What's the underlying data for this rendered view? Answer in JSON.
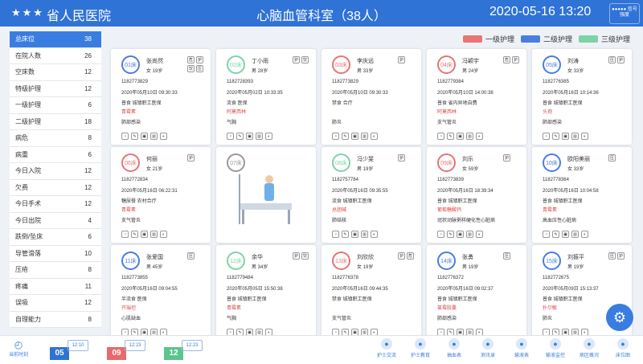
{
  "header": {
    "stars": "★★★",
    "hospital": "省人民医院",
    "department": "心脑血管科室（38人）",
    "datetime": "2020-05-16  13:20",
    "signal": "●●●●● 信号强度"
  },
  "sidebar": [
    {
      "label": "总床位",
      "count": "38",
      "active": true
    },
    {
      "label": "在院人数",
      "count": "26"
    },
    {
      "label": "空床数",
      "count": "12"
    },
    {
      "label": "特级护理",
      "count": "12"
    },
    {
      "label": "一级护理",
      "count": "6"
    },
    {
      "label": "二级护理",
      "count": "18"
    },
    {
      "label": "病危",
      "count": "8"
    },
    {
      "label": "病重",
      "count": "6"
    },
    {
      "label": "今日入院",
      "count": "12"
    },
    {
      "label": "欠费",
      "count": "12"
    },
    {
      "label": "今日手术",
      "count": "12"
    },
    {
      "label": "今日出院",
      "count": "4"
    },
    {
      "label": "跌倒/坠床",
      "count": "6"
    },
    {
      "label": "导管滑落",
      "count": "10"
    },
    {
      "label": "压疮",
      "count": "8"
    },
    {
      "label": "疼痛",
      "count": "11"
    },
    {
      "label": "误吸",
      "count": "12"
    },
    {
      "label": "自理能力",
      "count": "8"
    }
  ],
  "legend": [
    {
      "label": "一级护理",
      "color": "#e87474"
    },
    {
      "label": "二级护理",
      "color": "#4a7de0"
    },
    {
      "label": "三级护理",
      "color": "#7dd3a8"
    }
  ],
  "patients": [
    {
      "bed": "01床",
      "name": "张尚然",
      "sex": "女",
      "age": "19岁",
      "id": "1182773829",
      "date": "2020年05月10日",
      "time": "09:30:33",
      "diet": "普食",
      "ins": "城镇职工医保",
      "alert": "青霉素",
      "diag": "肺部感染",
      "color": "#4a7de0",
      "tags": [
        "危",
        "护",
        "饮",
        "压"
      ]
    },
    {
      "bed": "02床",
      "name": "丁小雨",
      "sex": "男",
      "age": "28岁",
      "id": "1182728393",
      "date": "2020年05月02日",
      "time": "10:33:35",
      "diet": "流食",
      "ins": "医保",
      "alert": "阿莫西林",
      "diag": "气胸",
      "color": "#7dd3a8",
      "tags": [
        "护",
        "饮"
      ]
    },
    {
      "bed": "03床",
      "name": "李庆远",
      "sex": "男",
      "age": "33岁",
      "id": "1182773829",
      "date": "2020年05月10日",
      "time": "09:30:33",
      "diet": "禁食",
      "ins": "合疗",
      "alert": "",
      "diag": "肺炎",
      "color": "#e87474",
      "tags": [
        "护"
      ]
    },
    {
      "bed": "04床",
      "name": "冯颖宇",
      "sex": "男",
      "age": "24岁",
      "id": "1182779384",
      "date": "2020年05月10日",
      "time": "14:00:38",
      "diet": "普食",
      "ins": "省内异地自费",
      "alert": "阿莫西林",
      "diag": "支气管炎",
      "color": "#e87474",
      "tags": [
        "危",
        "护"
      ]
    },
    {
      "bed": "05床",
      "name": "刘涛",
      "sex": "女",
      "age": "33岁",
      "id": "1182776385",
      "date": "2020年05月16日",
      "time": "10:14:36",
      "diet": "普食",
      "ins": "城镇职工医保",
      "alert": "头孢",
      "diag": "肺部感染",
      "color": "#4a7de0",
      "tags": [
        "压",
        "护"
      ]
    },
    {
      "bed": "06床",
      "name": "何丽",
      "sex": "女",
      "age": "21岁",
      "id": "1182772834",
      "date": "2020年05月16日",
      "time": "06:22:31",
      "diet": "糖尿餐",
      "ins": "农村合疗",
      "alert": "青霉素",
      "diag": "支气管炎",
      "color": "#e87474",
      "tags": [
        "护"
      ]
    },
    {
      "bed": "07床",
      "empty": true,
      "color": "#999999"
    },
    {
      "bed": "08床",
      "name": "冯少斐",
      "sex": "男",
      "age": "19岁",
      "id": "1182757784",
      "date": "2020年05月16日",
      "time": "09:35:55",
      "diet": "流食",
      "ins": "城镇职工医保",
      "alert": "总胆碱",
      "diag": "肺结核",
      "color": "#7dd3a8",
      "tags": [
        "护"
      ]
    },
    {
      "bed": "09床",
      "name": "刘乐",
      "sex": "女",
      "age": "59岁",
      "id": "1182773839",
      "date": "2020年05月16日",
      "time": "18:39:34",
      "diet": "普食",
      "ins": "城镇职工医保",
      "alert": "葡萄糖酸钙",
      "diag": "冠状动脉粥样硬化性心脏病",
      "color": "#e87474",
      "tags": [
        "护"
      ]
    },
    {
      "bed": "10床",
      "name": "欧阳美丽",
      "sex": "女",
      "age": "33岁",
      "id": "1182778364",
      "date": "2020年05月16日",
      "time": "10:04:58",
      "diet": "普食",
      "ins": "城镇职工医保",
      "alert": "青霉素",
      "diag": "高血压性心脏病",
      "color": "#4a7de0",
      "tags": [
        "压"
      ]
    },
    {
      "bed": "11床",
      "name": "张爱国",
      "sex": "男",
      "age": "45岁",
      "id": "1182773855",
      "date": "2020年05月16日",
      "time": "09:04:55",
      "diet": "半流食",
      "ins": "医保",
      "alert": "开瑞坦",
      "diag": "心肌缺血",
      "color": "#4a7de0",
      "tags": [
        "压"
      ]
    },
    {
      "bed": "12床",
      "name": "余华",
      "sex": "男",
      "age": "34岁",
      "id": "1182779484",
      "date": "2020年05月05日",
      "time": "15:50:38",
      "diet": "普食",
      "ins": "城镇职工医保",
      "alert": "青霉素",
      "diag": "气胸",
      "color": "#7dd3a8",
      "tags": [
        "护",
        "饮"
      ]
    },
    {
      "bed": "13床",
      "name": "刘欣欣",
      "sex": "女",
      "age": "19岁",
      "id": "1182776378",
      "date": "2020年05月16日",
      "time": "09:44:35",
      "diet": "禁食",
      "ins": "城镇职工医保",
      "alert": "",
      "diag": "支气管炎",
      "color": "#e87474",
      "tags": [
        "护",
        "危"
      ]
    },
    {
      "bed": "14床",
      "name": "张勇",
      "sex": "男",
      "age": "19岁",
      "id": "1182776372",
      "date": "2020年05月16日",
      "time": "09:02:37",
      "diet": "普食",
      "ins": "城镇职工医保",
      "alert": "氯霉胶囊",
      "diag": "肺部感染",
      "color": "#4a7de0",
      "tags": [
        "压"
      ]
    },
    {
      "bed": "15床",
      "name": "刘振平",
      "sex": "男",
      "age": "19岁",
      "id": "1182772675",
      "date": "2020年05月09日",
      "time": "15:13:37",
      "diet": "普食",
      "ins": "城镇职工医保",
      "alert": "扑尔敏",
      "diag": "肺炎",
      "color": "#4a7de0",
      "tags": [
        "压",
        "护"
      ]
    }
  ],
  "bottom": {
    "current": "当前时刻",
    "shifts": [
      {
        "num": "05",
        "time": "12:10",
        "color": "#2f73d6"
      },
      {
        "num": "09",
        "time": "12:23",
        "color": "#e86a6a"
      },
      {
        "num": "12",
        "time": "12:23",
        "color": "#5cc48c"
      }
    ],
    "buttons": [
      "护士交流",
      "护士教育",
      "抽血表",
      "测讯录",
      "输液表",
      "输液监控",
      "病区概况",
      "床位图"
    ]
  }
}
